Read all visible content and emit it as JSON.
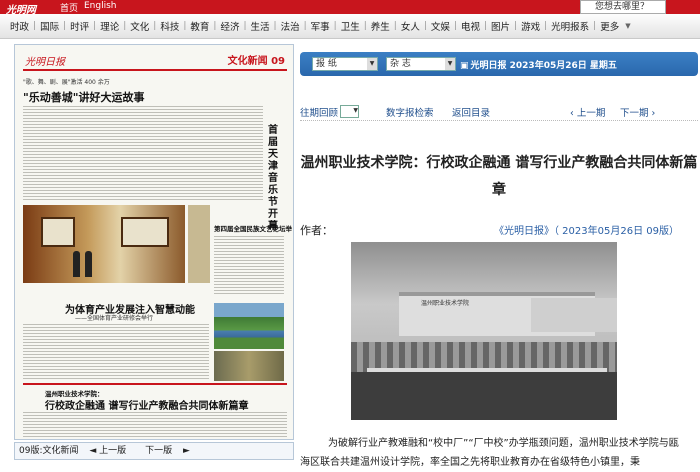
{
  "topbar": {
    "logo": "光明网",
    "links": [
      "首页",
      "English"
    ],
    "search_placeholder": "您想去哪里？"
  },
  "nav": {
    "items": [
      "时政",
      "国际",
      "时评",
      "理论",
      "文化",
      "科技",
      "教育",
      "经济",
      "生活",
      "法治",
      "军事",
      "卫生",
      "养生",
      "女人",
      "文娱",
      "电视",
      "图片",
      "游戏",
      "光明报系",
      "更多"
    ]
  },
  "paper": {
    "logo": "光明日报",
    "section": "文化新闻 09",
    "kicker1": "\"歌、舞、剧、展\"激活 400 余万",
    "headline1": "\"乐动善城\"讲好大运故事",
    "vertical_headline": "首届天津音乐节开幕",
    "sub_head": "第四届全国民族文艺论坛举行",
    "headline2": "为体育产业发展注入智慧动能",
    "sub2": "——全国体育产业研修会举行",
    "boxed_label": "温州职业技术学院：",
    "boxed_headline": "行校政企融通  谱写行业产教融合共同体新篇章"
  },
  "left_bottom": {
    "edition": "09版:文化新闻",
    "prev": "上一版",
    "next": "下一版"
  },
  "selectors": {
    "newspaper": "报  纸",
    "magazine": "杂  志",
    "date_line": "光明日报  2023年05月26日  星期五"
  },
  "toolbar": {
    "back_issue": "往期回顾",
    "issue_value": "",
    "digital_search": "数字报检索",
    "return_toc": "返回目录",
    "prev_page": "上一期",
    "next_page": "下一期"
  },
  "article": {
    "title": "温州职业技术学院：行校政企融通 谱写行业产教融合共同体新篇章",
    "author_label": "作者：",
    "source": "《光明日报》（ 2023年05月26日   09版）",
    "photo_banner": "温州职业技术学院",
    "paragraph": "为破解行业产教难融和“校中厂”“厂中校”办学瓶颈问题，温州职业技术学院与瓯海区联合共建温州设计学院，率全国之先将职业教育办在省级特色小镇里，秉"
  }
}
